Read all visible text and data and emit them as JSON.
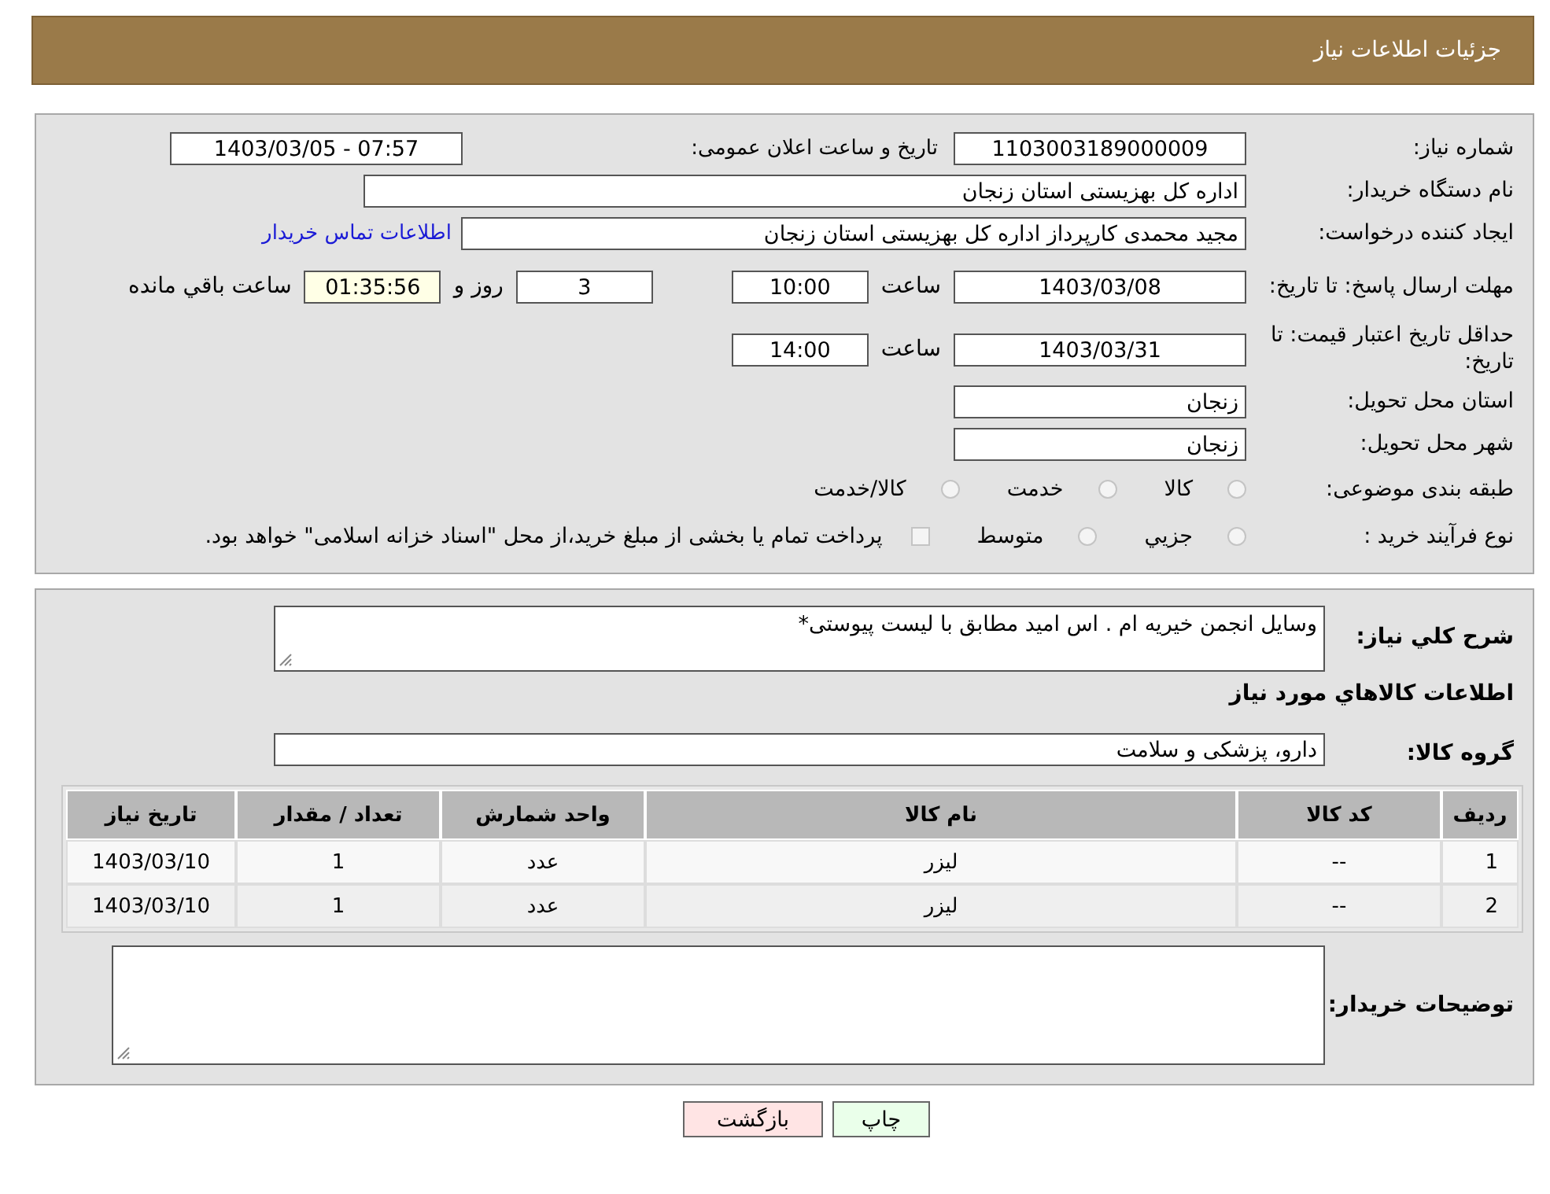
{
  "header": {
    "title": "جزئیات اطلاعات نیاز"
  },
  "need_number": {
    "label": "شماره نیاز:",
    "value": "1103003189000009"
  },
  "announce": {
    "label": "تاریخ و ساعت اعلان عمومی:",
    "value": "1403/03/05 - 07:57"
  },
  "buyer_org": {
    "label": "نام دستگاه خریدار:",
    "value": "اداره کل بهزیستی استان زنجان"
  },
  "requester": {
    "label": "ایجاد کننده درخواست:",
    "value": "مجید محمدی کارپرداز اداره کل بهزیستی استان زنجان",
    "link": "اطلاعات تماس خریدار"
  },
  "deadline": {
    "label": "مهلت ارسال پاسخ: تا تاریخ:",
    "date": "1403/03/08",
    "time_label": "ساعت",
    "time": "10:00",
    "days": "3",
    "days_label": "روز و",
    "remaining": "01:35:56",
    "remaining_label": "ساعت باقي مانده"
  },
  "validity": {
    "label": "حداقل تاریخ اعتبار قیمت: تا تاریخ:",
    "date": "1403/03/31",
    "time_label": "ساعت",
    "time": "14:00"
  },
  "province": {
    "label": "استان محل تحویل:",
    "value": "زنجان"
  },
  "city": {
    "label": "شهر محل تحویل:",
    "value": "زنجان"
  },
  "category": {
    "label": "طبقه بندی موضوعی:",
    "options": [
      {
        "kind": "radio",
        "label": "کالا",
        "selected": false
      },
      {
        "kind": "radio",
        "label": "خدمت",
        "selected": false
      },
      {
        "kind": "radio",
        "label": "کالا/خدمت",
        "selected": false
      }
    ]
  },
  "process": {
    "label": "نوع فرآیند خرید :",
    "options": [
      {
        "kind": "radio",
        "label": "جزيي",
        "selected": false
      },
      {
        "kind": "radio",
        "label": "متوسط",
        "selected": false
      },
      {
        "kind": "checkbox",
        "label": "پرداخت تمام یا بخشی از مبلغ خرید،از محل \"اسناد خزانه اسلامی\" خواهد بود.",
        "checked": false
      }
    ]
  },
  "description": {
    "label": "شرح کلي نياز:",
    "value": "وسایل انجمن خیریه ام . اس امید مطابق با لیست پیوستی*"
  },
  "goods_heading": "اطلاعات کالاهاي مورد نياز",
  "goods_group": {
    "label": "گروه کالا:",
    "value": "دارو، پزشکی و سلامت"
  },
  "table": {
    "columns": [
      "ردیف",
      "کد کالا",
      "نام کالا",
      "واحد شمارش",
      "تعداد / مقدار",
      "تاریخ نیاز"
    ],
    "rows": [
      [
        "1",
        "--",
        "لیزر",
        "عدد",
        "1",
        "1403/03/10"
      ],
      [
        "2",
        "--",
        "لیزر",
        "عدد",
        "1",
        "1403/03/10"
      ]
    ]
  },
  "buyer_notes": {
    "label": "توضیحات خریدار:"
  },
  "buttons": [
    {
      "kind": "print",
      "label": "چاپ"
    },
    {
      "kind": "back",
      "label": "بازگشت"
    }
  ]
}
